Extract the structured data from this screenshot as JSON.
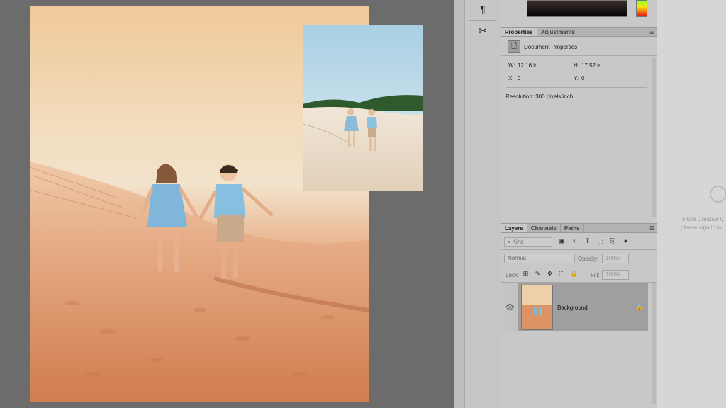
{
  "toolbar": {
    "tools": [
      {
        "icon": "paragraph-icon",
        "glyph": "¶"
      },
      {
        "icon": "tools-icon",
        "glyph": "✂"
      }
    ]
  },
  "colors": {
    "canvas_bg": "#6c6c6c",
    "panel_bg": "#c8c8c8",
    "layer_selected": "#9f9f9f"
  },
  "properties_panel": {
    "tabs": [
      {
        "label": "Properties",
        "active": true
      },
      {
        "label": "Adjustments",
        "active": false
      }
    ],
    "header": "Document Properties",
    "width_label": "W:",
    "width_value": "12.16 in",
    "height_label": "H:",
    "height_value": "17.52 in",
    "x_label": "X:",
    "x_value": "0",
    "y_label": "Y:",
    "y_value": "0",
    "resolution": "Resolution: 300 pixels/inch"
  },
  "layers_panel": {
    "tabs": [
      {
        "label": "Layers",
        "active": true
      },
      {
        "label": "Channels",
        "active": false
      },
      {
        "label": "Paths",
        "active": false
      }
    ],
    "filter_kind": "Kind",
    "blend_mode": "Normal",
    "opacity_label": "Opacity:",
    "opacity_value": "100%",
    "lock_label": "Lock:",
    "fill_label": "Fill:",
    "fill_value": "100%",
    "layers": [
      {
        "name": "Background",
        "visible": true,
        "locked": true
      }
    ]
  },
  "cc_panel": {
    "line1": "To use Creative C",
    "line2": "please sign in to"
  }
}
